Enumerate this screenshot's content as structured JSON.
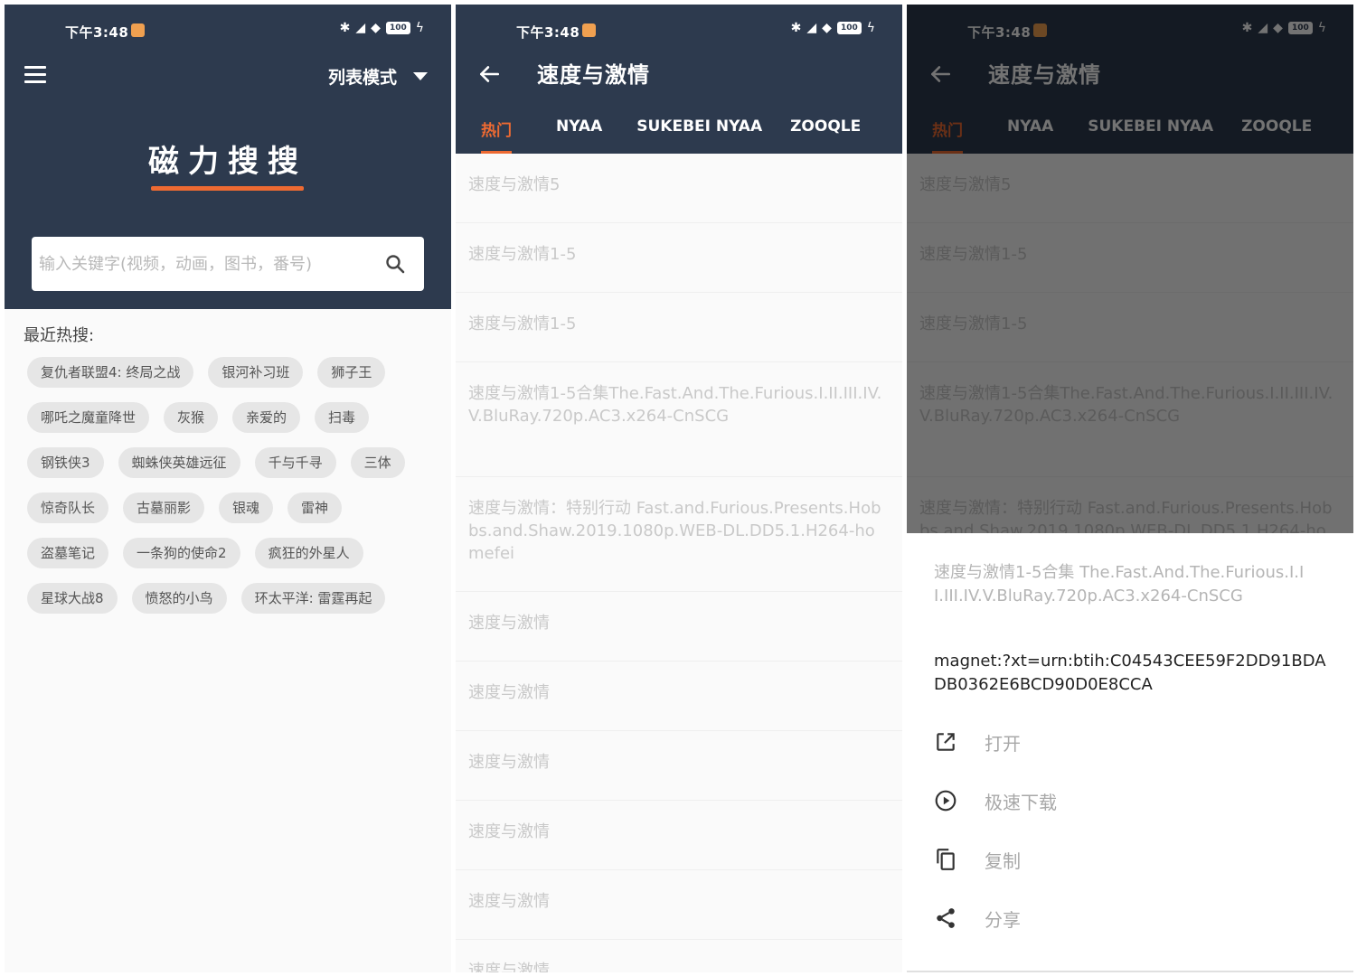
{
  "status": {
    "time": "下午3:48",
    "battery": "100"
  },
  "home": {
    "mode_label": "列表模式",
    "app_title": "磁力搜搜",
    "search_placeholder": "输入关键字(视频，动画，图书，番号)",
    "recent_label": "最近热搜:",
    "chips": [
      [
        "复仇者联盟4: 终局之战",
        "银河补习班",
        "狮子王"
      ],
      [
        "哪吒之魔童降世",
        "灰猴",
        "亲爱的",
        "扫毒"
      ],
      [
        "钢铁侠3",
        "蜘蛛侠英雄远征",
        "千与千寻",
        "三体"
      ],
      [
        "惊奇队长",
        "古墓丽影",
        "银魂",
        "雷神"
      ],
      [
        "盗墓笔记",
        "一条狗的使命2",
        "疯狂的外星人"
      ],
      [
        "星球大战8",
        "愤怒的小鸟",
        "环太平洋: 雷霆再起"
      ]
    ]
  },
  "results": {
    "title": "速度与激情",
    "tabs": [
      "热门",
      "NYAA",
      "SUKEBEI NYAA",
      "ZOOQLE"
    ],
    "items": [
      "速度与激情5",
      "速度与激情1-5",
      "速度与激情1-5",
      "速度与激情1-5合集The.Fast.And.The.Furious.I.II.III.IV.V.BluRay.720p.AC3.x264-CnSCG",
      "速度与激情：特别行动 Fast.and.Furious.Presents.Hobbs.and.Shaw.2019.1080p.WEB-DL.DD5.1.H264-homefei",
      "速度与激情",
      "速度与激情",
      "速度与激情",
      "速度与激情",
      "速度与激情",
      "速度与激情"
    ]
  },
  "sheet": {
    "title": "速度与激情1-5合集 The.Fast.And.The.Furious.I.II.III.IV.V.BluRay.720p.AC3.x264-CnSCG",
    "magnet": "magnet:?xt=urn:btih:C04543CEE59F2DD91BDADB0362E6BCD90D0E8CCA",
    "actions": [
      "打开",
      "极速下载",
      "复制",
      "分享"
    ]
  },
  "colors": {
    "header": "#2d3a4e",
    "accent": "#ee6a32"
  },
  "icons": [
    "menu-icon",
    "chevron-down-icon",
    "search-icon",
    "back-arrow-icon",
    "open-external-icon",
    "play-circle-icon",
    "copy-icon",
    "share-icon"
  ]
}
